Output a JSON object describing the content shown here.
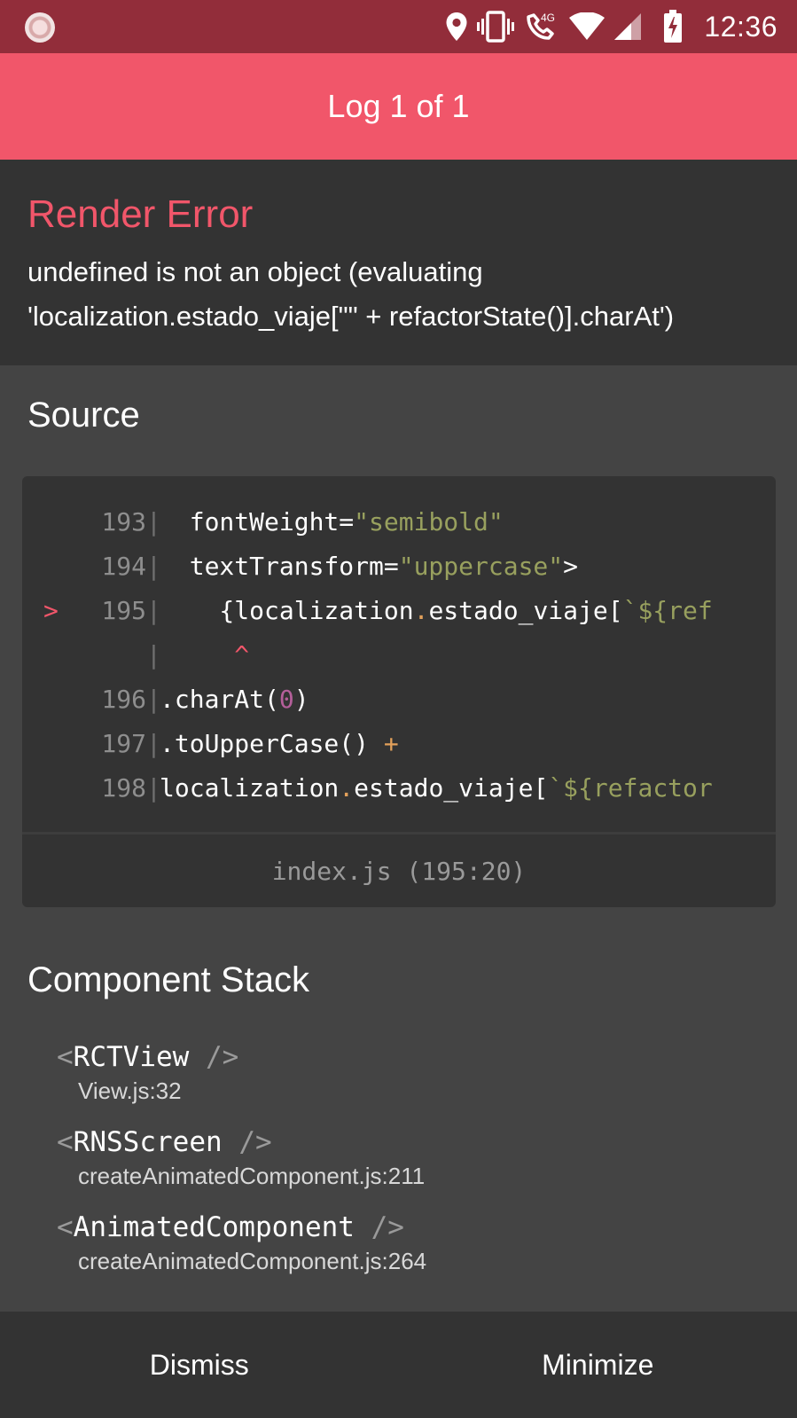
{
  "status_bar": {
    "time": "12:36",
    "network_label": "4G",
    "icons": [
      "app-notification-icon",
      "location-icon",
      "vibrate-icon",
      "wifi-calling-icon",
      "wifi-icon",
      "cell-signal-icon",
      "battery-charging-icon"
    ]
  },
  "header": {
    "title": "Log 1 of 1"
  },
  "error": {
    "title": "Render Error",
    "message": "undefined is not an object (evaluating 'localization.estado_viaje[\"\" + refactorState()].charAt')"
  },
  "source": {
    "title": "Source",
    "lines": [
      {
        "number": "193",
        "marker": "",
        "code": "  fontWeight=\"semibold\""
      },
      {
        "number": "194",
        "marker": "",
        "code": "  textTransform=\"uppercase\">"
      },
      {
        "number": "195",
        "marker": ">",
        "code": "    {localization.estado_viaje[`${ref"
      },
      {
        "number": "",
        "marker": "",
        "code": "     ^"
      },
      {
        "number": "196",
        "marker": "",
        "code": ".charAt(0)"
      },
      {
        "number": "197",
        "marker": "",
        "code": ".toUpperCase() +"
      },
      {
        "number": "198",
        "marker": "",
        "code": "localization.estado_viaje[`${refactor"
      }
    ],
    "file_location": "index.js (195:20)"
  },
  "component_stack": {
    "title": "Component Stack",
    "frames": [
      {
        "name": "RCTView",
        "location": "View.js:32"
      },
      {
        "name": "RNSScreen",
        "location": "createAnimatedComponent.js:211"
      },
      {
        "name": "AnimatedComponent",
        "location": "createAnimatedComponent.js:264"
      }
    ]
  },
  "actions": {
    "dismiss": "Dismiss",
    "minimize": "Minimize"
  },
  "colors": {
    "header": "#f1566a",
    "status_bar": "#922d3a",
    "error_title": "#f1566a",
    "code_bg": "#333333",
    "string": "#98a05e",
    "punctuation": "#e3a15b",
    "number": "#b45f9a"
  }
}
